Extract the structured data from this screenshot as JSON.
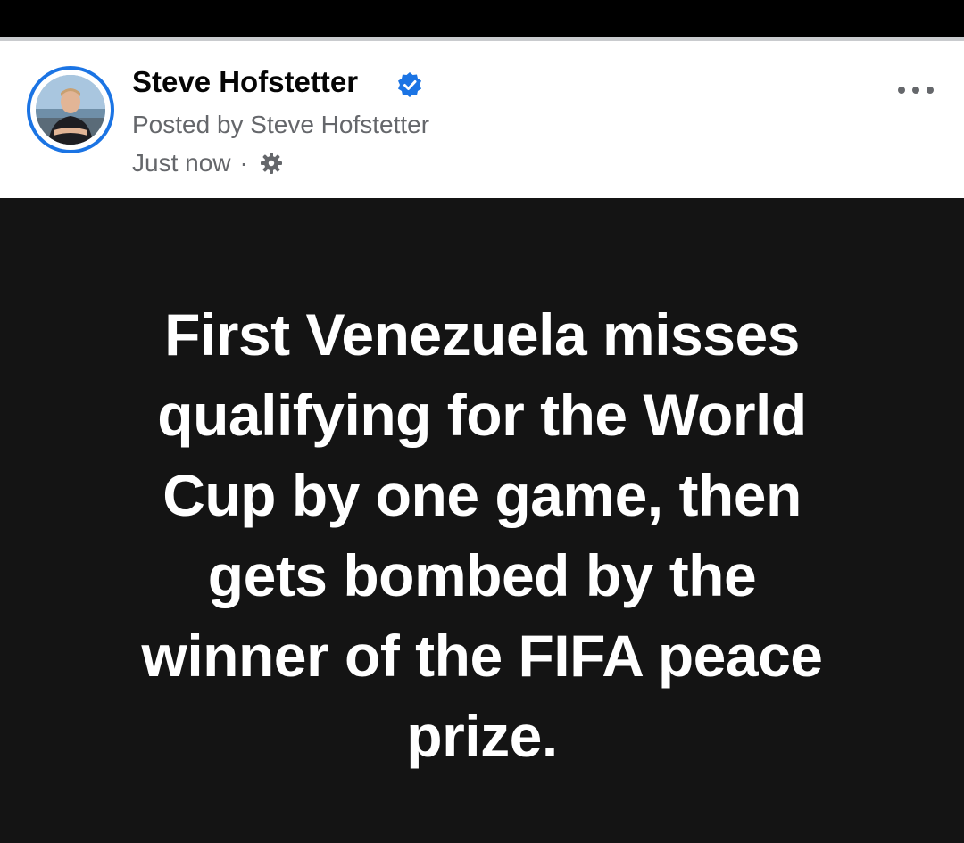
{
  "post": {
    "author": "Steve Hofstetter",
    "posted_by": "Posted by Steve Hofstetter",
    "timestamp": "Just now",
    "separator": "·",
    "verified_icon": "verified-badge-icon",
    "privacy_icon": "gear-icon",
    "more_icon": "more-options-icon",
    "text_lines": [
      "First Venezuela misses",
      "qualifying for the World",
      "Cup by one game, then",
      "gets bombed by the",
      "winner of the FIFA peace",
      "prize."
    ]
  },
  "colors": {
    "brand_blue": "#1b74e4",
    "post_background": "#141414",
    "header_background": "#ffffff",
    "secondary_text": "#65676b"
  }
}
